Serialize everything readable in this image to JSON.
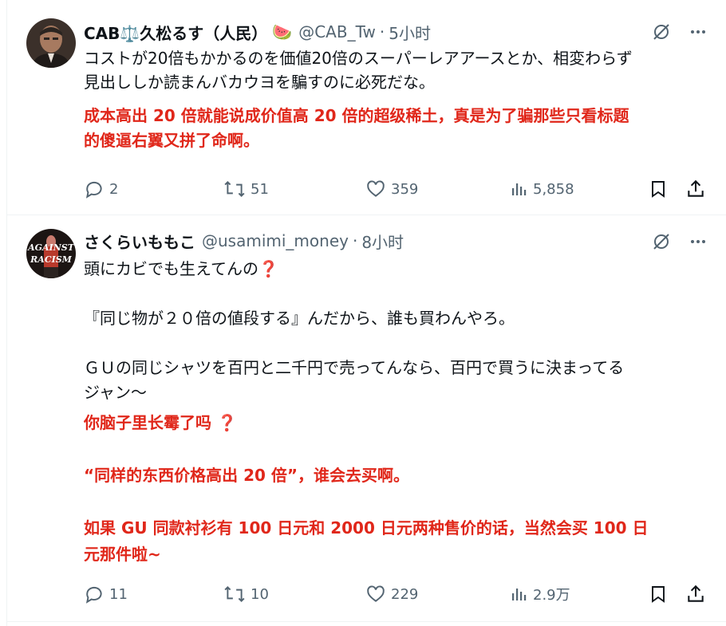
{
  "tweets": [
    {
      "name": "CAB⚖️久松るす（人民）",
      "emoji": "🍉",
      "handle": "@CAB_Tw",
      "time": "5小时",
      "text_lines": [
        "コストが20倍もかかるのを価値20倍のスーパーレアアースとか、相変わらず",
        "見出ししか読まんバカウヨを騙すのに必死だな。"
      ],
      "translation_lines": [
        "成本高出 20 倍就能说成价值高 20 倍的超级稀土，真是为了骗那些只看标题",
        "的傻逼右翼又拼了命啊。"
      ],
      "replies": "2",
      "retweets": "51",
      "likes": "359",
      "views": "5,858"
    },
    {
      "name": "さくらいももこ",
      "handle": "@usamimi_money",
      "time": "8小时",
      "text_lines": [
        "頭にカビでも生えてんの❓",
        "",
        "『同じ物が２０倍の値段する』んだから、誰も買わんやろ。",
        "",
        "ＧＵの同じシャツを百円と二千円で売ってんなら、百円で買うに決まってる",
        "ジャン〜"
      ],
      "translation_lines": [
        "你脑子里长霉了吗 ❓",
        "",
        "“同样的东西价格高出 20 倍”，谁会去买啊。",
        "",
        "如果 GU 同款衬衫有 100 日元和 2000 日元两种售价的话，当然会买 100 日",
        "元那件啦~"
      ],
      "avatar_text": "AGAINST RACISM",
      "replies": "11",
      "retweets": "10",
      "likes": "229",
      "views": "2.9万"
    }
  ],
  "colors": {
    "red": "#e0271a",
    "gray": "#536471",
    "text": "#0f1419"
  },
  "icons": [
    "grok-icon",
    "more-icon",
    "reply-icon",
    "retweet-icon",
    "like-icon",
    "views-icon",
    "bookmark-icon",
    "share-icon"
  ]
}
